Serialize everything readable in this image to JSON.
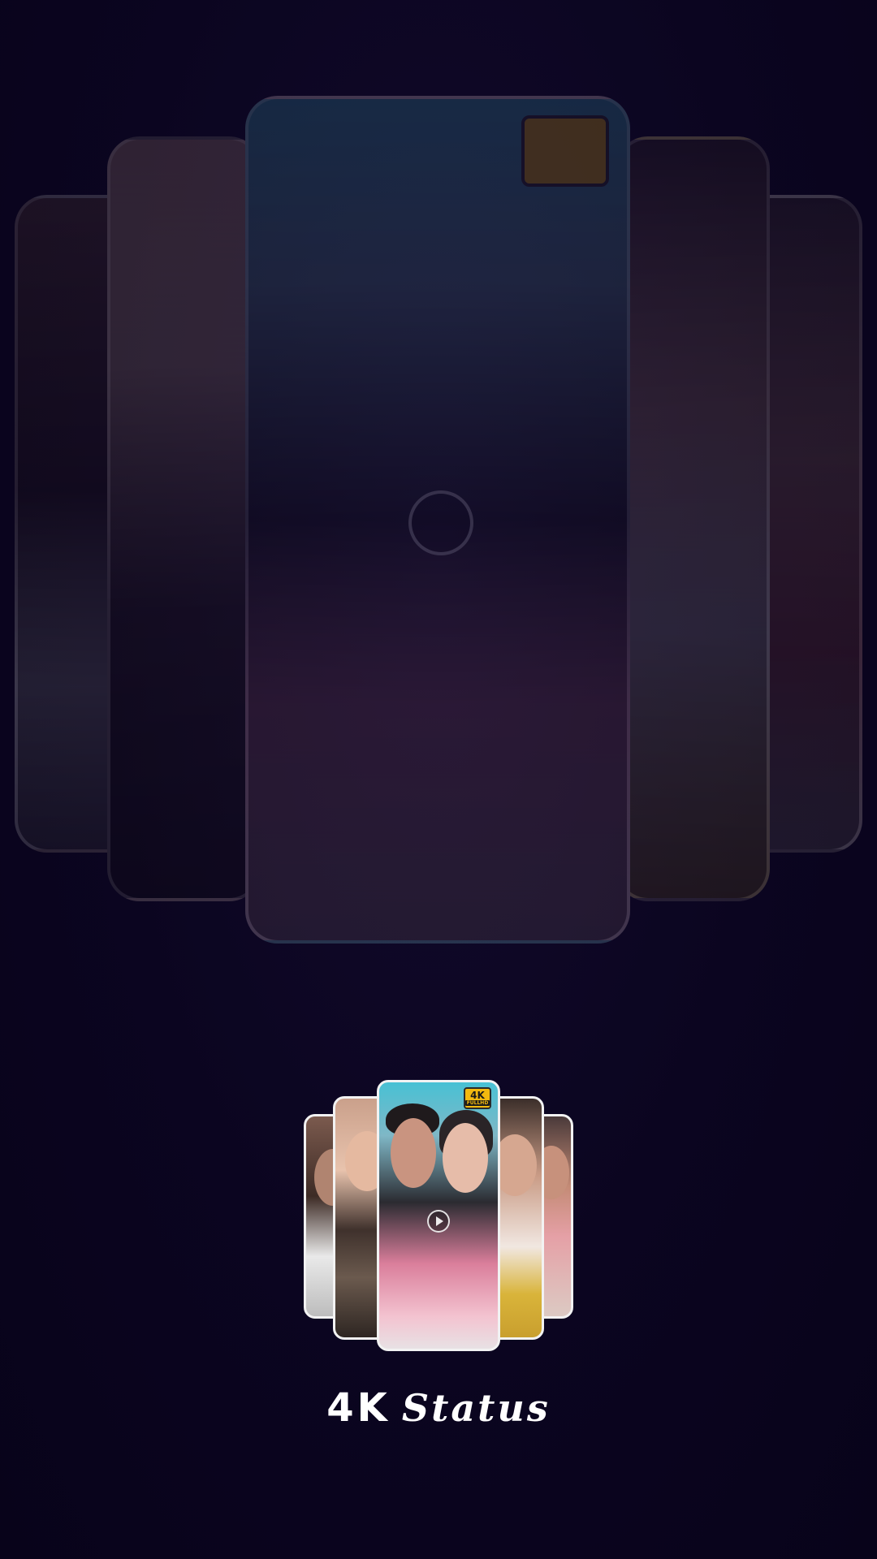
{
  "splash": {
    "app_name_main": "4K",
    "app_name_script": "Status",
    "badge": {
      "top": "4K",
      "bottom": "FULLHD"
    },
    "play_icon": "play-icon",
    "colors": {
      "background": "#0b0520",
      "badge": "#f3b90f",
      "text": "#ffffff"
    }
  }
}
